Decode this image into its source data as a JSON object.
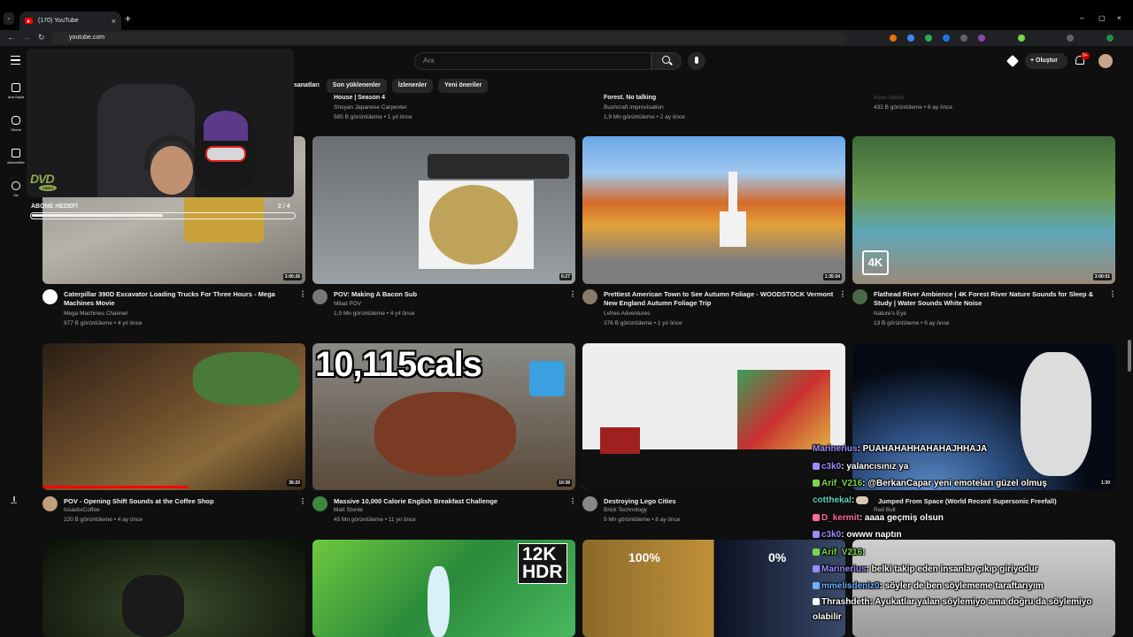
{
  "browser": {
    "tab_title": "(170) YouTube",
    "tab_close": "×",
    "new_tab": "+",
    "tab_list": "⌄",
    "url": "youtube.com",
    "win_min": "–",
    "win_max": "▢",
    "win_close": "×",
    "back": "←",
    "forward": "→",
    "reload": "↻"
  },
  "youtube": {
    "search_placeholder": "Ara",
    "create_label": "+ Oluştur",
    "notifications_badge": "9+",
    "chips": [
      "sanatları",
      "Son yüklenenler",
      "İzlenenler",
      "Yeni öneriler"
    ],
    "sidebar": [
      {
        "label": "Ana Sayfa"
      },
      {
        "label": "Shorts"
      },
      {
        "label": "Abonelikler"
      },
      {
        "label": "Siz"
      }
    ]
  },
  "prev_row": [
    {
      "title": "House | Season 4",
      "channel": "Shoyan Japanese Carpenter",
      "meta": "585 B görüntüleme • 1 yıl önce"
    },
    {
      "title": "Forest. No talking",
      "channel": "Bushcraft improvisation",
      "meta": "1,9 Mn görüntüleme • 2 ay önce"
    },
    {
      "title": "",
      "channel": "Asuo Vision",
      "meta": "432 B görüntüleme • 6 ay önce"
    }
  ],
  "overlay": {
    "dvd": "DVD",
    "dvd_sub": "VIDEO",
    "goal_label": "ABONE HEDEFİ",
    "goal_count": "2 / 4",
    "goal_progress": 0.5
  },
  "videos_row1": [
    {
      "title": "Caterpillar 390D Excavator Loading Trucks For Three Hours - Mega Machines Movie",
      "channel": "Mega Machines Channel",
      "meta": "977 B görüntüleme • 4 yıl önce",
      "duration": "3:00:26"
    },
    {
      "title": "POV: Making A Bacon Sub",
      "channel": "Milad POV",
      "meta": "1,9 Mn görüntüleme • 4 yıl önce",
      "duration": "6:27"
    },
    {
      "title": "Prettiest American Town to See Autumn Foliage - WOODSTOCK Vermont New England Autumn Foliage Trip",
      "channel": "Lvfree Adventures",
      "meta": "376 B görüntüleme • 1 yıl önce",
      "duration": "1:35:54"
    },
    {
      "title": "Flathead River Ambience | 4K Forest River Nature Sounds for Sleep & Study | Water Sounds White Noise",
      "channel": "Nature's Eye",
      "meta": "13 B görüntüleme • 6 ay önce",
      "duration": "3:00:01",
      "badge": "4K"
    }
  ],
  "videos_row2": [
    {
      "title": "POV - Opening Shift Sounds at the Coffee Shop",
      "channel": "IssackxCoffee",
      "meta": "220 B görüntüleme • 4 ay önce",
      "duration": "36:20"
    },
    {
      "title": "Massive 10,000 Calorie English Breakfast Challenge",
      "channel": "Matt Stonie",
      "meta": "45 Mn görüntüleme • 11 yıl önce",
      "duration": "10:38",
      "overlay_text": "10,115cals"
    },
    {
      "title": "Destroying Lego Cities",
      "channel": "Brick Technology",
      "meta": "9 Mn görüntüleme • 8 ay önce",
      "duration": ""
    },
    {
      "title": "Jumped From Space (World Record Supersonic Freefall)",
      "channel": "Red Bull",
      "meta": "",
      "duration": "1:30"
    }
  ],
  "row3": {
    "hdr_text": "12K\nHDR",
    "pct_left": "100%",
    "pct_right": "0%"
  },
  "chat": [
    {
      "user": "Marinerius",
      "msg": ": PUAHAHAHHAHAHAJHHAJA",
      "color": "#9b8cff"
    },
    {
      "user": "c3k0",
      "msg": ": yalancısınız ya",
      "color": "#9b8cff"
    },
    {
      "user": "Arif_V216",
      "msg": ": @BerkanCapar yeni emoteları güzel olmuş",
      "color": "#7cd648"
    },
    {
      "user": "cotthekal",
      "msg": ":",
      "color": "#5fd3c0"
    },
    {
      "user": "D_kermit",
      "msg": ": aaaa geçmiş olsun",
      "color": "#ff6a9a"
    },
    {
      "user": "c3k0",
      "msg": ": owww naptın",
      "color": "#9b8cff"
    },
    {
      "user": "Arif_V216",
      "msg": ":",
      "color": "#7cd648"
    },
    {
      "user": "Marinerius",
      "msg": ": belki takip eden insanlar çıkıp giriyodur",
      "color": "#9b8cff"
    },
    {
      "user": "mmelisdeniz0",
      "msg": ": söyler de ben söylememe taraftarıyım",
      "color": "#6fb2ff"
    },
    {
      "user": "Thrashdeth",
      "msg": ": Ayukatlar yalan söylemiyo ama doğru da söylemiyo",
      "color": "#ffffff"
    },
    {
      "user": "",
      "msg": "olabilir",
      "color": "#ffffff"
    }
  ]
}
